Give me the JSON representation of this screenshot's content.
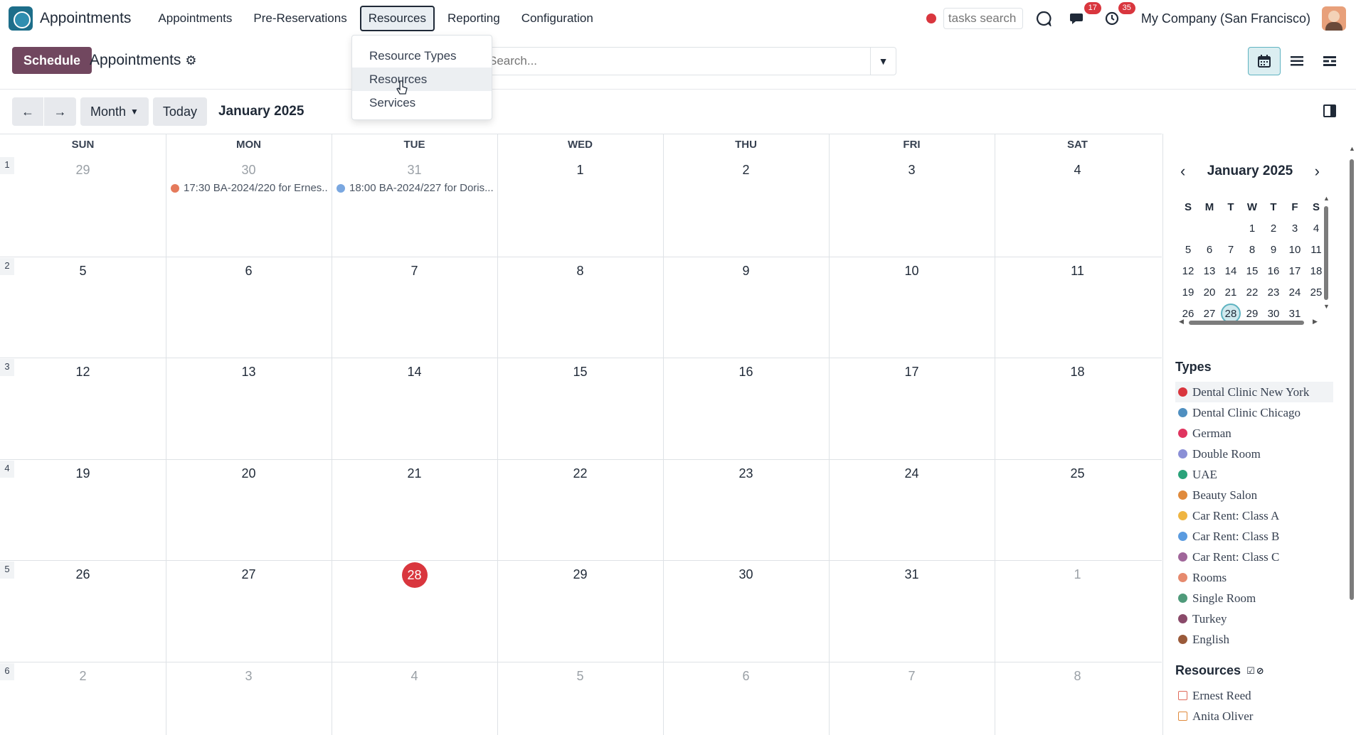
{
  "topnav": {
    "app_title": "Appointments",
    "menu": [
      "Appointments",
      "Pre-Reservations",
      "Resources",
      "Reporting",
      "Configuration"
    ],
    "active_menu": "Resources",
    "tasks_search_placeholder": "tasks search",
    "messages_badge": "17",
    "activities_badge": "35",
    "company": "My Company (San Francisco)"
  },
  "resources_menu": {
    "items": [
      "Resource Types",
      "Resources",
      "Services"
    ],
    "hovered": "Resources"
  },
  "control_panel": {
    "schedule_label": "Schedule",
    "page_title": "Appointments",
    "search_placeholder": "Search...",
    "views": [
      "calendar",
      "list",
      "gantt"
    ],
    "active_view": "calendar"
  },
  "toolbar": {
    "prev": "←",
    "next": "→",
    "scale_label": "Month",
    "today_label": "Today",
    "range_title": "January 2025"
  },
  "calendar": {
    "day_names": [
      "SUN",
      "MON",
      "TUE",
      "WED",
      "THU",
      "FRI",
      "SAT"
    ],
    "week_numbers": [
      "1",
      "2",
      "3",
      "4",
      "5",
      "6"
    ],
    "weeks": [
      [
        "29",
        "30",
        "31",
        "1",
        "2",
        "3",
        "4"
      ],
      [
        "5",
        "6",
        "7",
        "8",
        "9",
        "10",
        "11"
      ],
      [
        "12",
        "13",
        "14",
        "15",
        "16",
        "17",
        "18"
      ],
      [
        "19",
        "20",
        "21",
        "22",
        "23",
        "24",
        "25"
      ],
      [
        "26",
        "27",
        "28",
        "29",
        "30",
        "31",
        "1"
      ],
      [
        "2",
        "3",
        "4",
        "5",
        "6",
        "7",
        "8"
      ]
    ],
    "today": "28",
    "today_color": "#d9363e",
    "events": [
      {
        "label": "17:30 BA-2024/220 for Ernes...",
        "color": "#e57a5b"
      },
      {
        "label": "18:00 BA-2024/227 for Doris...",
        "color": "#7aa7e0"
      }
    ]
  },
  "mini_calendar": {
    "title": "January 2025",
    "day_initials": [
      "S",
      "M",
      "T",
      "W",
      "T",
      "F",
      "S"
    ],
    "weeks": [
      [
        "",
        "",
        "",
        "1",
        "2",
        "3",
        "4"
      ],
      [
        "5",
        "6",
        "7",
        "8",
        "9",
        "10",
        "11"
      ],
      [
        "12",
        "13",
        "14",
        "15",
        "16",
        "17",
        "18"
      ],
      [
        "19",
        "20",
        "21",
        "22",
        "23",
        "24",
        "25"
      ],
      [
        "26",
        "27",
        "28",
        "29",
        "30",
        "31",
        ""
      ]
    ],
    "selected": "28"
  },
  "types": {
    "title": "Types",
    "items": [
      {
        "label": "Dental Clinic New York",
        "color": "#d9363e"
      },
      {
        "label": "Dental Clinic Chicago",
        "color": "#4f8fc0"
      },
      {
        "label": "German",
        "color": "#e0345f"
      },
      {
        "label": "Double Room",
        "color": "#8a8fd6"
      },
      {
        "label": "UAE",
        "color": "#2aa37a"
      },
      {
        "label": "Beauty Salon",
        "color": "#e08a3c"
      },
      {
        "label": "Car Rent: Class A",
        "color": "#efb542"
      },
      {
        "label": "Car Rent: Class B",
        "color": "#5a9be0"
      },
      {
        "label": "Car Rent: Class C",
        "color": "#a0669a"
      },
      {
        "label": "Rooms",
        "color": "#e68a6e"
      },
      {
        "label": "Single Room",
        "color": "#4f9a7a"
      },
      {
        "label": "Turkey",
        "color": "#8a4a6a"
      },
      {
        "label": "English",
        "color": "#9a5a3a"
      }
    ]
  },
  "resources": {
    "title": "Resources",
    "items": [
      {
        "label": "Ernest Reed",
        "color": "#e06a5a"
      },
      {
        "label": "Anita Oliver",
        "color": "#e08a3c"
      }
    ]
  }
}
